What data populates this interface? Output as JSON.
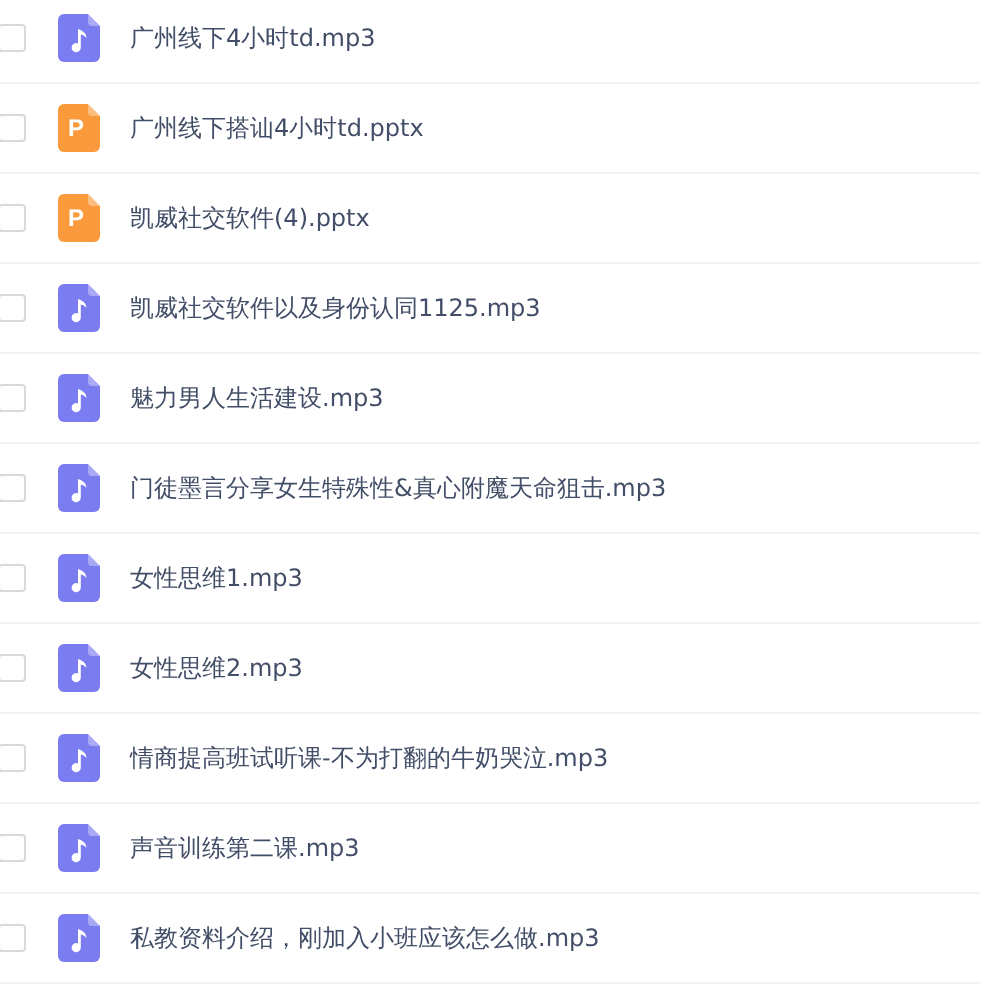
{
  "files": [
    {
      "name": "广州线下4小时td.mp3",
      "kind": "audio",
      "checked": false
    },
    {
      "name": "广州线下搭讪4小时td.pptx",
      "kind": "slides",
      "icon_text": "P",
      "checked": false
    },
    {
      "name": "凯威社交软件(4).pptx",
      "kind": "slides",
      "icon_text": "P",
      "checked": false
    },
    {
      "name": "凯威社交软件以及身份认同1125.mp3",
      "kind": "audio",
      "checked": false
    },
    {
      "name": "魅力男人生活建设.mp3",
      "kind": "audio",
      "checked": false
    },
    {
      "name": "门徒墨言分享女生特殊性&真心附魔天命狙击.mp3",
      "kind": "audio",
      "checked": false
    },
    {
      "name": "女性思维1.mp3",
      "kind": "audio",
      "checked": false
    },
    {
      "name": "女性思维2.mp3",
      "kind": "audio",
      "checked": false
    },
    {
      "name": "情商提高班试听课-不为打翻的牛奶哭泣.mp3",
      "kind": "audio",
      "checked": false
    },
    {
      "name": "声音训练第二课.mp3",
      "kind": "audio",
      "checked": false
    },
    {
      "name": "私教资料介绍，刚加入小班应该怎么做.mp3",
      "kind": "audio",
      "checked": false
    }
  ]
}
